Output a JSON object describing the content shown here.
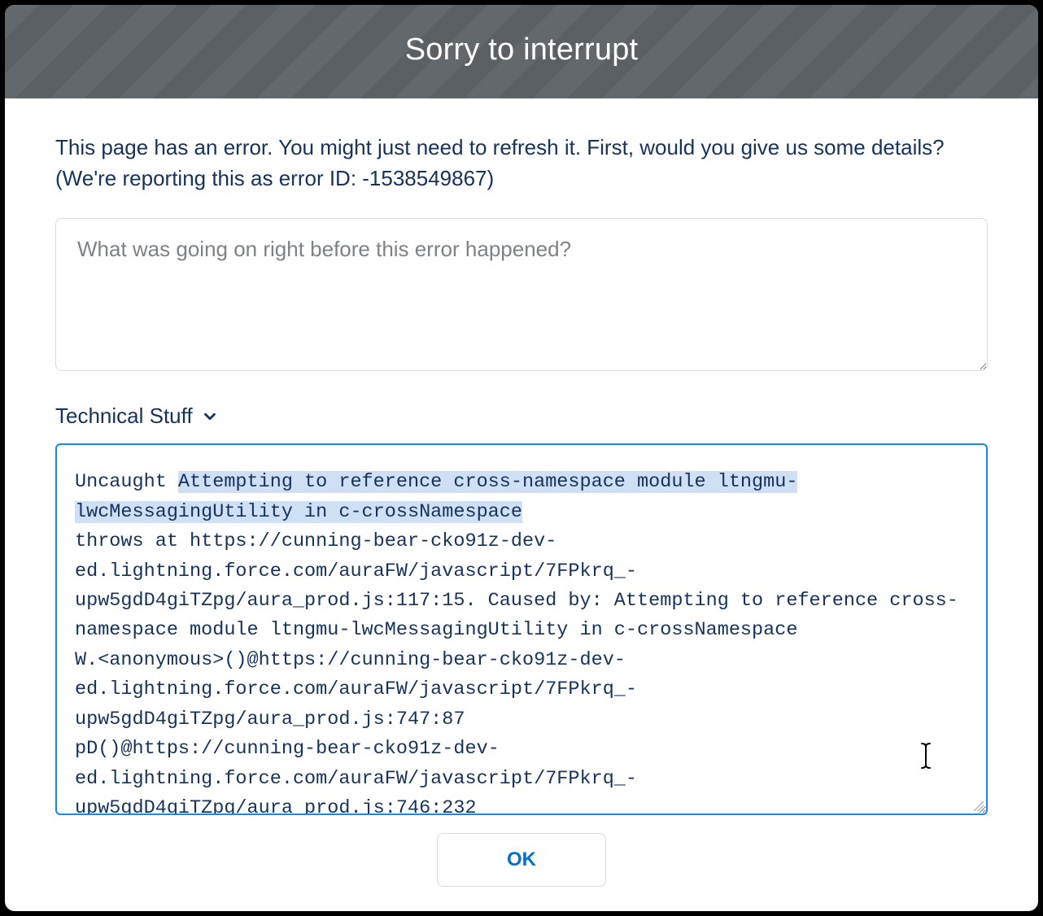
{
  "header": {
    "title": "Sorry to interrupt"
  },
  "body": {
    "prompt_line1": "This page has an error. You might just need to refresh it. First, would you give us some details?",
    "prompt_line2": "(We're reporting this as error ID: -1538549867)",
    "error_id": "-1538549867",
    "input_placeholder": "What was going on right before this error happened?"
  },
  "technical": {
    "toggle_label": "Technical Stuff",
    "expanded": true,
    "selection_text": "Attempting to reference cross-namespace module ltngmu-lwcMessagingUtility in c-crossNamespace",
    "stack_pre": "Uncaught ",
    "stack_post": "\nthrows at https://cunning-bear-cko91z-dev-ed.lightning.force.com/auraFW/javascript/7FPkrq_-upw5gdD4giTZpg/aura_prod.js:117:15. Caused by: Attempting to reference cross-namespace module ltngmu-lwcMessagingUtility in c-crossNamespace\nW.<anonymous>()@https://cunning-bear-cko91z-dev-ed.lightning.force.com/auraFW/javascript/7FPkrq_-upw5gdD4giTZpg/aura_prod.js:747:87\npD()@https://cunning-bear-cko91z-dev-ed.lightning.force.com/auraFW/javascript/7FPkrq_-upw5gdD4giTZpg/aura_prod.js:746:232"
  },
  "footer": {
    "ok_label": "OK"
  }
}
